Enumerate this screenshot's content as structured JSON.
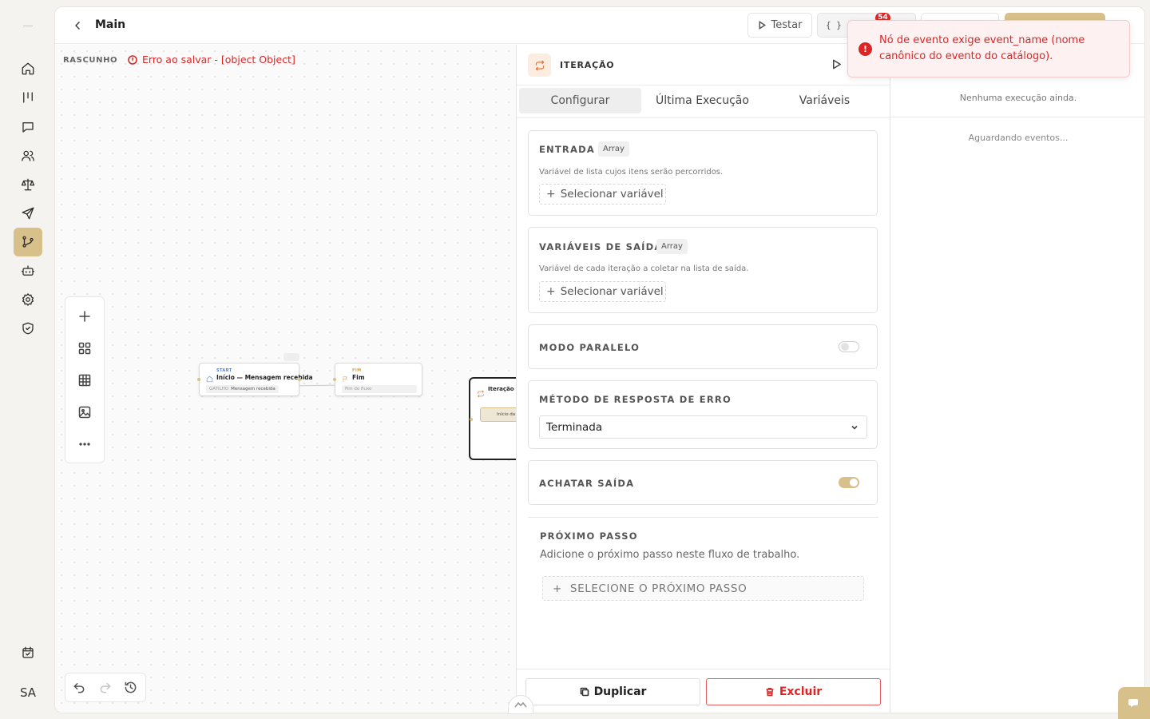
{
  "app": {
    "nav_icons": [
      "home-icon",
      "kanban-icon",
      "chat-icon",
      "users-icon",
      "scale-icon",
      "send-icon",
      "workflow-icon",
      "bot-icon",
      "gear-icon",
      "shield-check-icon"
    ],
    "active_nav": "workflow-icon",
    "bottom_icon": "calendar-check-icon",
    "avatar_initials": "SA",
    "accent_color": "#d8c08b",
    "error_color": "#dc2626"
  },
  "topbar": {
    "title": "Main",
    "test_label": "Testar",
    "code_label": "{ }",
    "error_count": "54"
  },
  "canvas": {
    "status": "RASCUNHO",
    "save_error": "Erro ao salvar - [object Object]",
    "nodes": {
      "start": {
        "kind": "START",
        "title": "Início — Mensagem recebida",
        "pill_key": "GATILHO",
        "pill_value": "Mensagem recebida"
      },
      "end": {
        "kind": "FIM",
        "title": "Fim",
        "pill_value": "Fim do fluxo"
      },
      "iteration": {
        "title": "Iteração",
        "inner": "Início da iteração"
      }
    }
  },
  "panel": {
    "title": "ITERAÇÃO",
    "tabs": [
      "Configurar",
      "Última Execução",
      "Variáveis"
    ],
    "active_tab": "Configurar",
    "input": {
      "label": "ENTRADA",
      "type": "Array",
      "description": "Variável de lista cujos itens serão percorridos.",
      "select_label": "Selecionar variável"
    },
    "output": {
      "label": "VARIÁVEIS DE SAÍDA",
      "type": "Array",
      "description": "Variável de cada iteração a coletar na lista de saída.",
      "select_label": "Selecionar variável"
    },
    "parallel": {
      "label": "MODO PARALELO",
      "enabled": false
    },
    "error_method": {
      "label": "MÉTODO DE RESPOSTA DE ERRO",
      "value": "Terminada"
    },
    "flatten": {
      "label": "ACHATAR SAÍDA",
      "enabled": true
    },
    "next_step": {
      "label": "PRÓXIMO PASSO",
      "description": "Adicione o próximo passo neste fluxo de trabalho.",
      "button": "SELECIONE O PRÓXIMO PASSO"
    },
    "duplicate_label": "Duplicar",
    "delete_label": "Excluir"
  },
  "events": {
    "empty": "Nenhuma execução ainda.",
    "waiting": "Aguardando eventos..."
  },
  "toast": {
    "message": "Nó de evento exige event_name (nome canônico do evento do catálogo)."
  }
}
